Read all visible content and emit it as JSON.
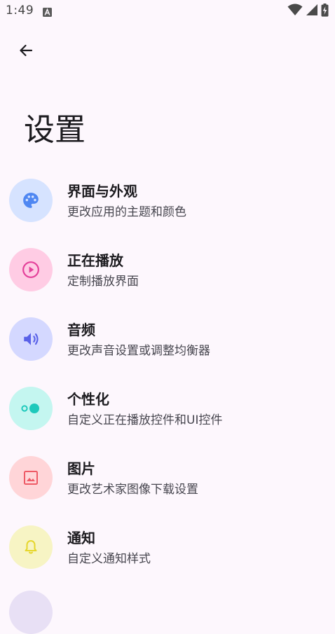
{
  "status_bar": {
    "time": "1:49",
    "notification_icon": "a-box-icon",
    "wifi_icon": "wifi-icon",
    "signal_icon": "cellular-signal-icon",
    "battery_icon": "battery-charging-icon"
  },
  "header": {
    "back_icon": "arrow-back-icon",
    "title": "设置"
  },
  "settings": [
    {
      "title": "界面与外观",
      "subtitle": "更改应用的主题和颜色",
      "icon": "palette-icon",
      "bg": "#d6e3ff",
      "fg": "#4f87f2"
    },
    {
      "title": "正在播放",
      "subtitle": "定制播放界面",
      "icon": "play-circle-icon",
      "bg": "#ffcce4",
      "fg": "#e4409a"
    },
    {
      "title": "音频",
      "subtitle": "更改声音设置或调整均衡器",
      "icon": "volume-icon",
      "bg": "#d4d8ff",
      "fg": "#5a62e8"
    },
    {
      "title": "个性化",
      "subtitle": "自定义正在播放控件和UI控件",
      "icon": "toggle-icon",
      "bg": "#c4f6f0",
      "fg": "#1ec9bb"
    },
    {
      "title": "图片",
      "subtitle": "更改艺术家图像下载设置",
      "icon": "image-icon",
      "bg": "#ffd5d8",
      "fg": "#ee5a66"
    },
    {
      "title": "通知",
      "subtitle": "自定义通知样式",
      "icon": "bell-icon",
      "bg": "#f7f4c4",
      "fg": "#e6d62b"
    }
  ],
  "partial_item": {
    "bg": "#e8e0f5"
  }
}
